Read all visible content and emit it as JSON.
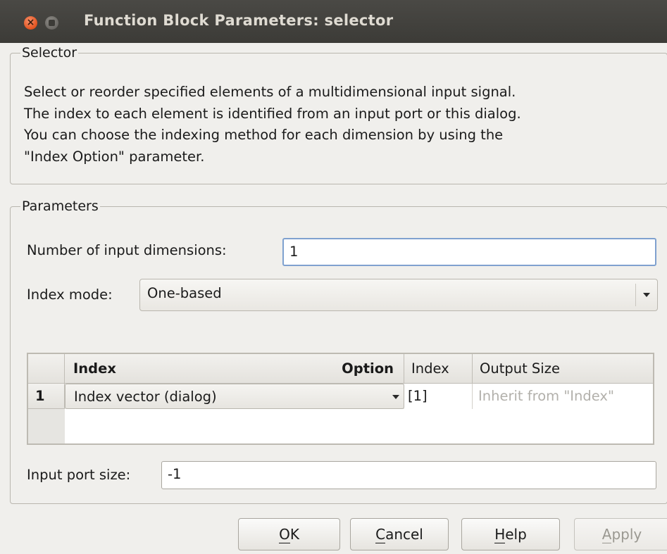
{
  "window": {
    "title": "Function Block Parameters: selector"
  },
  "selector_group": {
    "legend": "Selector",
    "description_lines": [
      "Select or reorder specified elements of a multidimensional input signal.",
      "The index to each element is identified from an input port or this dialog.",
      "You can choose the indexing method for each dimension by using the",
      "\"Index Option\" parameter."
    ]
  },
  "parameters_group": {
    "legend": "Parameters",
    "num_dims": {
      "label": "Number of input dimensions:",
      "value": "1"
    },
    "index_mode": {
      "label": "Index mode:",
      "value": "One-based"
    },
    "table": {
      "headers": [
        "Index",
        "Option",
        "Index",
        "Output Size"
      ],
      "rows": [
        {
          "row_num": "1",
          "option": "Index vector (dialog)",
          "index": "[1]",
          "output_size": "Inherit from \"Index\""
        }
      ]
    },
    "input_port_size": {
      "label": "Input port size:",
      "value": "-1"
    }
  },
  "buttons": {
    "ok": {
      "mnemonic": "O",
      "rest": "K"
    },
    "cancel": {
      "mnemonic": "C",
      "rest": "ancel"
    },
    "help": {
      "mnemonic": "H",
      "rest": "elp"
    },
    "apply": {
      "mnemonic": "A",
      "rest": "pply",
      "enabled": false
    }
  },
  "colors": {
    "titlebar": "#3c3b37",
    "close_button": "#e2531f",
    "focus_border": "#7fa1cf",
    "disabled_text": "#9a9891"
  },
  "icons": [
    "close-icon",
    "minimize-icon",
    "dropdown-arrow-icon"
  ]
}
